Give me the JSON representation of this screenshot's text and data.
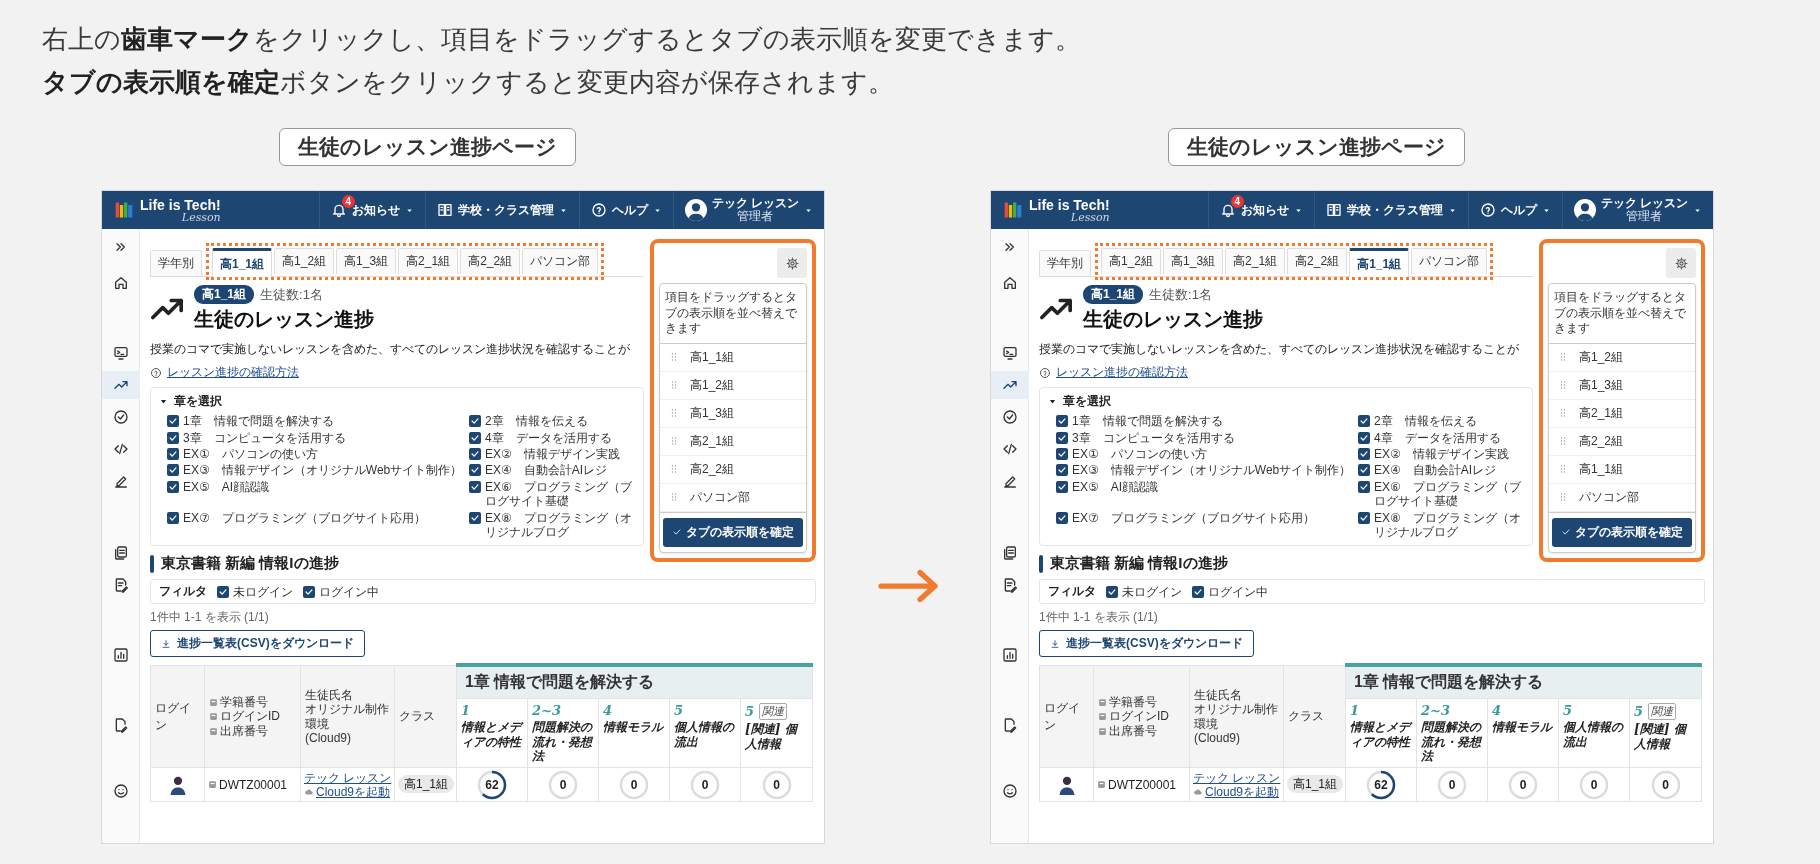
{
  "instructions": [
    "右上の**歯車マーク**をクリックし、項目をドラッグするとタブの表示順を変更できます。",
    "**タブの表示順を確定**ボタンをクリックすると変更内容が保存されます。"
  ],
  "screens": [
    {
      "caption": "生徒のレッスン進捗ページ",
      "header": {
        "logo": "Life is Tech!",
        "logo_sub": "Lesson",
        "menus": [
          {
            "kind": "notifications",
            "label": "お知らせ",
            "badge": "4"
          },
          {
            "kind": "school",
            "label": "学校・クラス管理"
          },
          {
            "kind": "help",
            "label": "ヘルプ"
          }
        ],
        "user": {
          "name": "テック レッスン",
          "role": "管理者"
        }
      },
      "sidebar": [
        {
          "kind": "expand",
          "selected": false
        },
        {
          "kind": "home",
          "selected": false
        },
        {
          "kind": "terminal",
          "selected": false
        },
        {
          "kind": "trend",
          "selected": true
        },
        {
          "kind": "check",
          "selected": false
        },
        {
          "kind": "code",
          "selected": false
        },
        {
          "kind": "pencil",
          "selected": false
        },
        {
          "kind": "docs",
          "selected": false
        },
        {
          "kind": "doc-edit",
          "selected": false
        },
        {
          "kind": "chart",
          "selected": false
        },
        {
          "kind": "file-edit",
          "selected": false
        },
        {
          "kind": "face",
          "selected": false
        }
      ],
      "tabs": [
        {
          "label": "学年別",
          "selected": false
        },
        {
          "label": "高1_1組",
          "selected": true
        },
        {
          "label": "高1_2組",
          "selected": false
        },
        {
          "label": "高1_3組",
          "selected": false
        },
        {
          "label": "高2_1組",
          "selected": false
        },
        {
          "label": "高2_2組",
          "selected": false
        },
        {
          "label": "パソコン部",
          "selected": false
        }
      ],
      "reorder_panel": {
        "hint": "項目をドラッグするとタブの表示順を並べ替えできます",
        "items": [
          "高1_1組",
          "高1_2組",
          "高1_3組",
          "高2_1組",
          "高2_2組",
          "パソコン部"
        ],
        "confirm": "タブの表示順を確定"
      },
      "class_badge": "高1_1組",
      "student_count": "生徒数:1名",
      "title": "生徒のレッスン進捗",
      "description": "授業のコマで実施しないレッスンを含めた、すべてのレッスン進捗状況を確認することが",
      "help_link": "レッスン進捗の確認方法",
      "chapter_select": {
        "label": "章を選択",
        "expanded": true,
        "items": [
          {
            "label": "1章　情報で問題を解決する",
            "checked": true
          },
          {
            "label": "2章　情報を伝える",
            "checked": true
          },
          {
            "label": "3章　コンピュータを活用する",
            "checked": true
          },
          {
            "label": "4章　データを活用する",
            "checked": true
          },
          {
            "label": "EX①　パソコンの使い方",
            "checked": true
          },
          {
            "label": "EX②　情報デザイン実践",
            "checked": true
          },
          {
            "label": "EX③　情報デザイン（オリジナルWebサイト制作）",
            "checked": true
          },
          {
            "label": "EX④　自動会計AIレジ",
            "checked": true
          },
          {
            "label": "EX⑤　AI顔認識",
            "checked": true
          },
          {
            "label": "EX⑥　プログラミング（ブログサイト基礎",
            "checked": true
          },
          {
            "label": "EX⑦　プログラミング（ブログサイト応用）",
            "checked": true
          },
          {
            "label": "EX⑧　プログラミング（オリジナルブログ",
            "checked": true
          }
        ]
      },
      "section_title": "東京書籍 新編 情報Iの進捗",
      "filter": {
        "label": "フィルタ",
        "options": [
          {
            "label": "未ログイン",
            "checked": true
          },
          {
            "label": "ログイン中",
            "checked": true
          }
        ]
      },
      "count": "1件中 1-1 を表示 (1/1)",
      "download": "進捗一覧表(CSV)をダウンロード",
      "table": {
        "login_header": "ログイン",
        "id_lines": [
          "学籍番号",
          "ログインID",
          "出席番号"
        ],
        "name_lines": [
          "生徒氏名",
          "オリジナル制作環境",
          "(Cloud9)"
        ],
        "class_header": "クラス",
        "chapter": "1章  情報で問題を解決する",
        "lessons": [
          {
            "number": "1",
            "title": "情報とメディアの特性"
          },
          {
            "number": "2~3",
            "title": "問題解決の流れ・発想法"
          },
          {
            "number": "4",
            "title": "情報モラル"
          },
          {
            "number": "5",
            "title": "個人情報の流出"
          },
          {
            "number": "5",
            "tag": "関連",
            "title": "[関連] 個人情報"
          }
        ],
        "rows": [
          {
            "login_id": "DWTZ00001",
            "name": "テック レッスン",
            "launch": "Cloud9を起動",
            "class": "高1_1組",
            "progress": [
              {
                "value": "62"
              },
              {
                "value": "0"
              },
              {
                "value": "0"
              },
              {
                "value": "0"
              },
              {
                "value": "0"
              }
            ]
          }
        ]
      }
    },
    {
      "caption": "生徒のレッスン進捗ページ",
      "header": {
        "logo": "Life is Tech!",
        "logo_sub": "Lesson",
        "menus": [
          {
            "kind": "notifications",
            "label": "お知らせ",
            "badge": "4"
          },
          {
            "kind": "school",
            "label": "学校・クラス管理"
          },
          {
            "kind": "help",
            "label": "ヘルプ"
          }
        ],
        "user": {
          "name": "テック レッスン",
          "role": "管理者"
        }
      },
      "sidebar": [
        {
          "kind": "expand",
          "selected": false
        },
        {
          "kind": "home",
          "selected": false
        },
        {
          "kind": "terminal",
          "selected": false
        },
        {
          "kind": "trend",
          "selected": true
        },
        {
          "kind": "check",
          "selected": false
        },
        {
          "kind": "code",
          "selected": false
        },
        {
          "kind": "pencil",
          "selected": false
        },
        {
          "kind": "docs",
          "selected": false
        },
        {
          "kind": "doc-edit",
          "selected": false
        },
        {
          "kind": "chart",
          "selected": false
        },
        {
          "kind": "file-edit",
          "selected": false
        },
        {
          "kind": "face",
          "selected": false
        }
      ],
      "tabs": [
        {
          "label": "学年別",
          "selected": false
        },
        {
          "label": "高1_2組",
          "selected": false
        },
        {
          "label": "高1_3組",
          "selected": false
        },
        {
          "label": "高2_1組",
          "selected": false
        },
        {
          "label": "高2_2組",
          "selected": false
        },
        {
          "label": "高1_1組",
          "selected": true
        },
        {
          "label": "パソコン部",
          "selected": false
        }
      ],
      "reorder_panel": {
        "hint": "項目をドラッグするとタブの表示順を並べ替えできます",
        "items": [
          "高1_2組",
          "高1_3組",
          "高2_1組",
          "高2_2組",
          "高1_1組",
          "パソコン部"
        ],
        "confirm": "タブの表示順を確定"
      },
      "class_badge": "高1_1組",
      "student_count": "生徒数:1名",
      "title": "生徒のレッスン進捗",
      "description": "授業のコマで実施しないレッスンを含めた、すべてのレッスン進捗状況を確認することが",
      "help_link": "レッスン進捗の確認方法",
      "chapter_select": {
        "label": "章を選択",
        "expanded": true,
        "items": [
          {
            "label": "1章　情報で問題を解決する",
            "checked": true
          },
          {
            "label": "2章　情報を伝える",
            "checked": true
          },
          {
            "label": "3章　コンピュータを活用する",
            "checked": true
          },
          {
            "label": "4章　データを活用する",
            "checked": true
          },
          {
            "label": "EX①　パソコンの使い方",
            "checked": true
          },
          {
            "label": "EX②　情報デザイン実践",
            "checked": true
          },
          {
            "label": "EX③　情報デザイン（オリジナルWebサイト制作）",
            "checked": true
          },
          {
            "label": "EX④　自動会計AIレジ",
            "checked": true
          },
          {
            "label": "EX⑤　AI顔認識",
            "checked": true
          },
          {
            "label": "EX⑥　プログラミング（ブログサイト基礎",
            "checked": true
          },
          {
            "label": "EX⑦　プログラミング（ブログサイト応用）",
            "checked": true
          },
          {
            "label": "EX⑧　プログラミング（オリジナルブログ",
            "checked": true
          }
        ]
      },
      "section_title": "東京書籍 新編 情報Iの進捗",
      "filter": {
        "label": "フィルタ",
        "options": [
          {
            "label": "未ログイン",
            "checked": true
          },
          {
            "label": "ログイン中",
            "checked": true
          }
        ]
      },
      "count": "1件中 1-1 を表示 (1/1)",
      "download": "進捗一覧表(CSV)をダウンロード",
      "table": {
        "login_header": "ログイン",
        "id_lines": [
          "学籍番号",
          "ログインID",
          "出席番号"
        ],
        "name_lines": [
          "生徒氏名",
          "オリジナル制作環境",
          "(Cloud9)"
        ],
        "class_header": "クラス",
        "chapter": "1章  情報で問題を解決する",
        "lessons": [
          {
            "number": "1",
            "title": "情報とメディアの特性"
          },
          {
            "number": "2~3",
            "title": "問題解決の流れ・発想法"
          },
          {
            "number": "4",
            "title": "情報モラル"
          },
          {
            "number": "5",
            "title": "個人情報の流出"
          },
          {
            "number": "5",
            "tag": "関連",
            "title": "[関連] 個人情報"
          }
        ],
        "rows": [
          {
            "login_id": "DWTZ00001",
            "name": "テック レッスン",
            "launch": "Cloud9を起動",
            "class": "高1_1組",
            "progress": [
              {
                "value": "62"
              },
              {
                "value": "0"
              },
              {
                "value": "0"
              },
              {
                "value": "0"
              },
              {
                "value": "0"
              }
            ]
          }
        ]
      }
    }
  ]
}
